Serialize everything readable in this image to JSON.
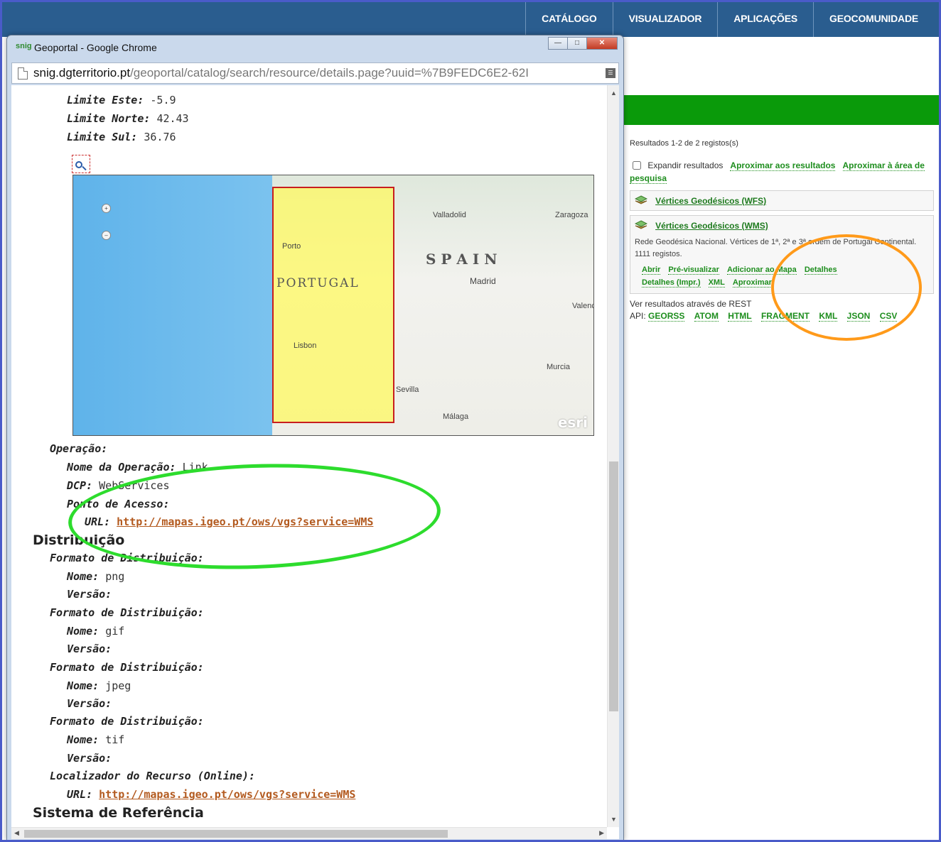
{
  "topnav": {
    "items": [
      "CATÁLOGO",
      "VISUALIZADOR",
      "APLICAÇÕES",
      "GEOCOMUNIDADE"
    ]
  },
  "results": {
    "count": "Resultados 1-2 de 2 registos(s)",
    "expand_label": "Expandir resultados",
    "zoom_results": "Aproximar aos resultados",
    "zoom_area": "Aproximar à área de pesquisa",
    "items": [
      {
        "title": "Vértices Geodésicos (WFS)"
      },
      {
        "title": "Vértices Geodésicos (WMS)",
        "description": "Rede Geodésica Nacional. Vértices de 1ª, 2ª e 3ª ordem de Portugal Continental. 1111 registos.",
        "actions": [
          "Abrir",
          "Pré-visualizar",
          "Adicionar ao Mapa",
          "Detalhes",
          "Detalhes (Impr.)",
          "XML",
          "Aproximar"
        ]
      }
    ],
    "rest_label": "Ver resultados através de REST",
    "api_label": "API:",
    "api_links": [
      "GEORSS",
      "ATOM",
      "HTML",
      "FRAGMENT",
      "KML",
      "JSON",
      "CSV"
    ]
  },
  "window": {
    "badge": "snig",
    "title": "Geoportal - Google Chrome",
    "url_domain": "snig.dgterritorio.pt",
    "url_path": "/geoportal/catalog/search/resource/details.page?uuid=%7B9FEDC6E2-62I"
  },
  "details": {
    "limite_este_label": "Limite Este:",
    "limite_este": "-5.9",
    "limite_norte_label": "Limite Norte:",
    "limite_norte": "42.43",
    "limite_sul_label": "Limite Sul:",
    "limite_sul": "36.76",
    "operacao_label": "Operação:",
    "nome_operacao_label": "Nome da Operação:",
    "nome_operacao": "Link",
    "dcp_label": "DCP:",
    "dcp": "WebServices",
    "ponto_acesso_label": "Ponto de Acesso:",
    "url_label": "URL:",
    "url": "http://mapas.igeo.pt/ows/vgs?service=WMS",
    "distribuicao_heading": "Distribuição",
    "formato_label": "Formato de Distribuição:",
    "nome_label": "Nome:",
    "versao_label": "Versão:",
    "formats": [
      "png",
      "gif",
      "jpeg",
      "tif"
    ],
    "localizador_label": "Localizador do Recurso (Online):",
    "online_url": "http://mapas.igeo.pt/ows/vgs?service=WMS",
    "sistema_heading": "Sistema de Referência"
  },
  "map": {
    "labels": {
      "portugal": "PORTUGAL",
      "spain": "S P A I N"
    },
    "cities": [
      "Porto",
      "Lisbon",
      "Valladolid",
      "Zaragoza",
      "Madrid",
      "Valencia",
      "Murcia",
      "Sevilla",
      "Málaga"
    ],
    "attribution": "esri"
  }
}
